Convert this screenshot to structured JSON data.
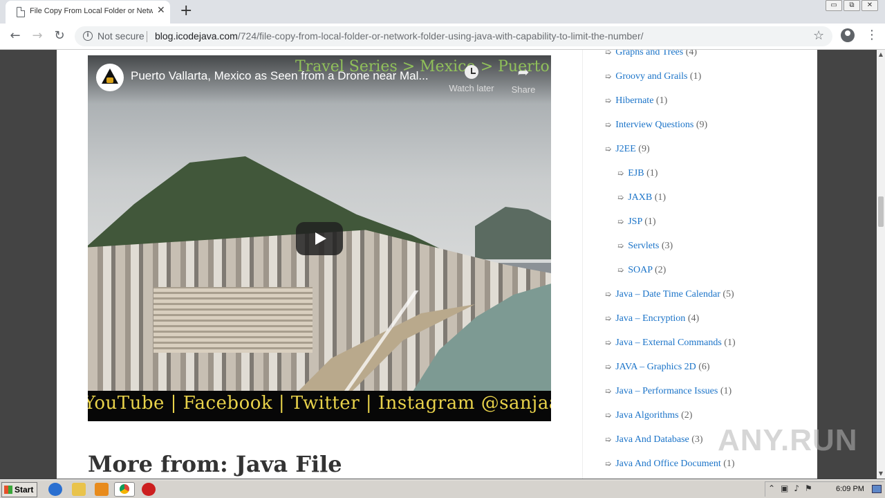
{
  "browser": {
    "tab_title": "File Copy From Local Folder or Network",
    "tab_close": "✕",
    "new_tab": "+",
    "security_label": "Not secure",
    "url_host": "blog.icodejava.com",
    "url_path": "/724/file-copy-from-local-folder-or-network-folder-using-java-with-capability-to-limit-the-number/",
    "window_controls": [
      "▭",
      "⧉",
      "✕"
    ]
  },
  "video": {
    "title": "Puerto Vallarta, Mexico as Seen from a Drone near Mal...",
    "watch_later": "Watch later",
    "share": "Share",
    "overlay_series": "Travel Series > Mexico > Puerto Valla",
    "banner_text": "YouTube | Facebook | Twitter | Instagram @sanjaalcorps"
  },
  "content": {
    "more_heading": "More from: Java File"
  },
  "sidebar": {
    "categories": [
      {
        "label": "Graphs and Trees",
        "count": "(4)",
        "indent": 0
      },
      {
        "label": "Groovy and Grails",
        "count": "(1)",
        "indent": 0
      },
      {
        "label": "Hibernate",
        "count": "(1)",
        "indent": 0
      },
      {
        "label": "Interview Questions",
        "count": "(9)",
        "indent": 0
      },
      {
        "label": "J2EE",
        "count": "(9)",
        "indent": 0
      },
      {
        "label": "EJB",
        "count": "(1)",
        "indent": 1
      },
      {
        "label": "JAXB",
        "count": "(1)",
        "indent": 1
      },
      {
        "label": "JSP",
        "count": "(1)",
        "indent": 1
      },
      {
        "label": "Servlets",
        "count": "(3)",
        "indent": 1
      },
      {
        "label": "SOAP",
        "count": "(2)",
        "indent": 1
      },
      {
        "label": "Java – Date Time Calendar",
        "count": "(5)",
        "indent": 0
      },
      {
        "label": "Java – Encryption",
        "count": "(4)",
        "indent": 0
      },
      {
        "label": "Java – External Commands",
        "count": "(1)",
        "indent": 0
      },
      {
        "label": "JAVA – Graphics 2D",
        "count": "(6)",
        "indent": 0
      },
      {
        "label": "Java – Performance Issues",
        "count": "(1)",
        "indent": 0
      },
      {
        "label": "Java Algorithms",
        "count": "(2)",
        "indent": 0
      },
      {
        "label": "Java And Database",
        "count": "(3)",
        "indent": 0
      },
      {
        "label": "Java And Office Document",
        "count": "(1)",
        "indent": 0
      }
    ]
  },
  "watermark": "ANY.RUN",
  "taskbar": {
    "start_label": "Start",
    "clock": "6:09 PM"
  },
  "colors": {
    "link": "#1a73c8",
    "banner_text": "#e8d24a",
    "page_bg": "#444444"
  }
}
